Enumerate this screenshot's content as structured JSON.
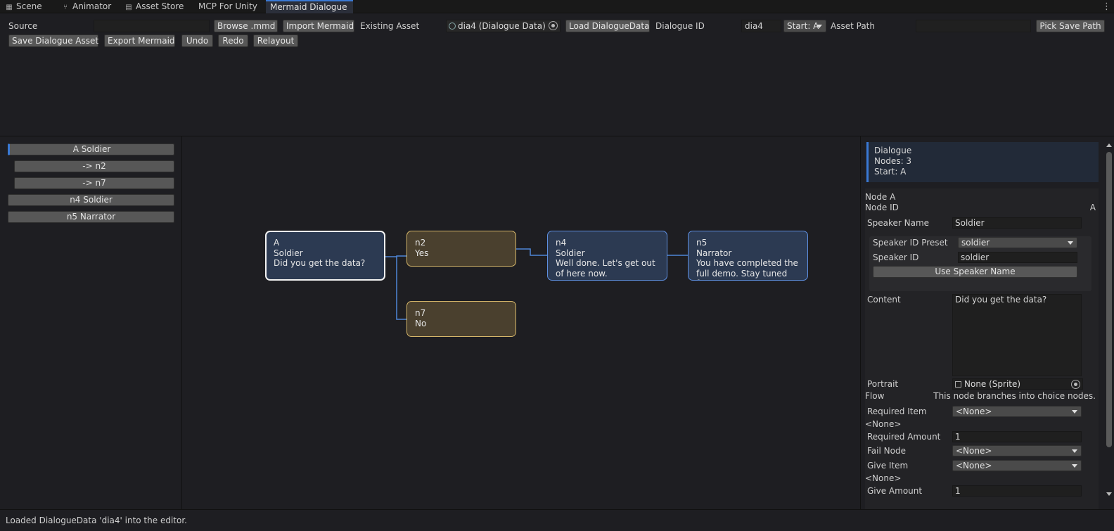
{
  "tabs": [
    {
      "label": "Scene",
      "icon": "grid-icon"
    },
    {
      "label": "Animator",
      "icon": "animator-icon"
    },
    {
      "label": "Asset Store",
      "icon": "bag-icon"
    },
    {
      "label": "MCP For Unity",
      "icon": ""
    },
    {
      "label": "Mermaid Dialogue",
      "icon": ""
    }
  ],
  "toolbar": {
    "source_label": "Source",
    "source_value": "",
    "browse_label": "Browse .mmd",
    "import_label": "Import Mermaid",
    "existing_asset_label": "Existing Asset",
    "existing_asset_value": "dia4 (Dialogue Data)",
    "load_label": "Load DialogueData",
    "dialogue_id_label": "Dialogue ID",
    "dialogue_id_value": "dia4",
    "start_value": "Start: A",
    "asset_path_label": "Asset Path",
    "asset_path_value": "",
    "pick_save_label": "Pick Save Path",
    "save_label": "Save Dialogue Asset",
    "export_label": "Export Mermaid",
    "undo_label": "Undo",
    "redo_label": "Redo",
    "relayout_label": "Relayout"
  },
  "node_list": [
    {
      "label": "A  Soldier"
    },
    {
      "label": "-> n2"
    },
    {
      "label": "-> n7"
    },
    {
      "label": "n4  Soldier"
    },
    {
      "label": "n5  Narrator"
    }
  ],
  "graph_nodes": [
    {
      "id": "A",
      "lines": [
        "A",
        "Soldier",
        "Did you get the data?"
      ]
    },
    {
      "id": "n2",
      "lines": [
        "n2",
        "Yes"
      ]
    },
    {
      "id": "n7",
      "lines": [
        "n7",
        "No"
      ]
    },
    {
      "id": "n4",
      "lines": [
        "n4",
        "Soldier",
        "Well done. Let's get out of here now."
      ]
    },
    {
      "id": "n5",
      "lines": [
        "n5",
        "Narrator",
        "You have completed the full demo. Stay tuned for..."
      ]
    }
  ],
  "inspector": {
    "summary_title": "Dialogue",
    "summary_nodes": "Nodes: 3",
    "summary_start": "Start: A",
    "node_title": "Node A",
    "node_id_label": "Node ID",
    "node_id_value": "A",
    "speaker_name_label": "Speaker Name",
    "speaker_name_value": "Soldier",
    "speaker_preset_label": "Speaker ID Preset",
    "speaker_preset_value": "soldier",
    "speaker_id_label": "Speaker ID",
    "speaker_id_value": "soldier",
    "use_speaker_label": "Use Speaker Name",
    "content_label": "Content",
    "content_value": "Did you get the data?",
    "portrait_label": "Portrait",
    "portrait_value": "None (Sprite)",
    "flow_label": "Flow",
    "flow_value": "This node branches into choice nodes.",
    "required_item_label": "Required Item",
    "required_item_value": "<None>",
    "required_item_note": "<None>",
    "required_amount_label": "Required Amount",
    "required_amount_value": "1",
    "fail_node_label": "Fail Node",
    "fail_node_value": "<None>",
    "give_item_label": "Give Item",
    "give_item_value": "<None>",
    "give_item_note": "<None>",
    "give_amount_label": "Give Amount",
    "give_amount_value": "1"
  },
  "status": "Loaded DialogueData 'dia4' into the editor.",
  "colors": {
    "accent": "#3a79d4",
    "speaker_node_fill": "#2c3a52",
    "speaker_node_border": "#5e8fe0",
    "choice_node_fill": "#4a402e",
    "choice_node_border": "#d5b66a",
    "edge": "#4f86d8"
  }
}
